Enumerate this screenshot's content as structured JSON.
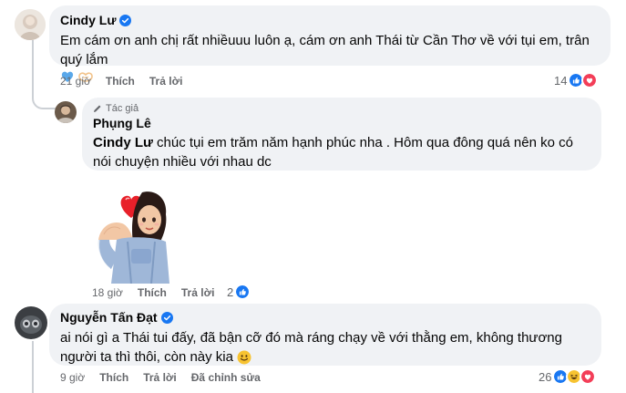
{
  "comments": [
    {
      "author": "Cindy Lư",
      "text": "Em cám ơn anh chị rất nhiềuuu luôn ạ, cám ơn anh Thái từ Cần Thơ về với tụi em, trân quý lắm",
      "time": "21 giờ",
      "like_label": "Thích",
      "reply_label": "Trả lời",
      "reaction_count": "14",
      "emojis": [
        "blue-heart",
        "heart-hands"
      ]
    },
    {
      "badge": "Tác giả",
      "author": "Phụng Lê",
      "mention": "Cindy Lư",
      "text": " chúc tụi em trăm năm hạnh phúc nha . Hôm qua đông quá nên ko có nói chuyện nhiều với nhau dc",
      "time": "18 giờ",
      "like_label": "Thích",
      "reply_label": "Trả lời",
      "reaction_count": "2",
      "sticker": "heart-girl-sticker"
    },
    {
      "author": "Nguyễn Tấn Đạt",
      "text": "ai nói gì a Thái tui đấy, đã bận cỡ đó mà ráng chạy về với thằng em, không thương người ta thì thôi, còn này kia",
      "time": "9 giờ",
      "like_label": "Thích",
      "reply_label": "Trả lời",
      "edited_label": "Đã chỉnh sửa",
      "reaction_count": "26",
      "emojis": [
        "smiling-face"
      ]
    }
  ],
  "colors": {
    "bubble": "#f0f2f5",
    "like_blue": "#1877f2",
    "love_red": "#f33e58",
    "muted": "#65676b"
  }
}
